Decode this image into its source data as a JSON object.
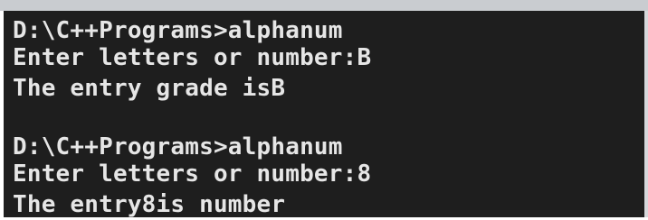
{
  "console": {
    "lines": [
      "D:\\C++Programs>alphanum",
      "Enter letters or number:B",
      "The entry grade isB",
      "",
      "D:\\C++Programs>alphanum",
      "Enter letters or number:8",
      "The entry8is number"
    ]
  },
  "colors": {
    "background": "#1e1e1e",
    "text": "#e6e6e6"
  }
}
